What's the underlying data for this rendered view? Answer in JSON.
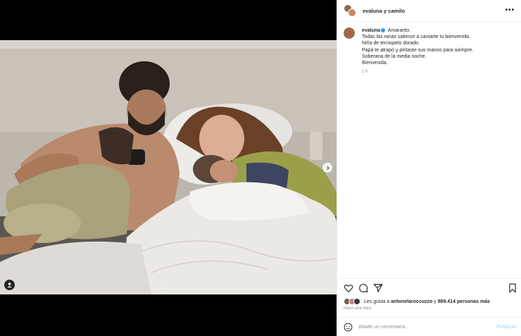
{
  "post": {
    "header_username": "evaluna y camilo",
    "more_label": "•••"
  },
  "caption": {
    "username": "evaluna",
    "lines": [
      "Amaranto.",
      "Todas las ranas salieron a cantarte tu bienvenida.",
      "Niña de terciopelo dorado.",
      "Papá te atrapó y pintaste sus manos para siempre.",
      "Soberana de la media noche.",
      "Bienvenida."
    ],
    "time": "1 h"
  },
  "likes": {
    "prefix": "Les gusta a ",
    "user": "antonelaroccuzzo",
    "middle": " y ",
    "count": "989.414 personas más"
  },
  "posted_time": "Hace una hora",
  "comment": {
    "placeholder": "Añade un comentario...",
    "publish_label": "Publicar"
  },
  "media": {
    "slide_count": 3,
    "active_slide": 1
  },
  "colors": {
    "verified": "#3897f0",
    "publish_disabled": "#b2dffc",
    "border": "#efefef"
  },
  "icons": [
    "tag-user-icon",
    "next-arrow-icon",
    "more-icon",
    "verified-icon",
    "heart-icon",
    "comment-icon",
    "share-icon",
    "bookmark-icon",
    "emoji-icon"
  ]
}
